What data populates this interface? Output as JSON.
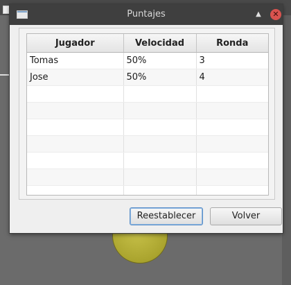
{
  "window": {
    "title": "Puntajes",
    "maximize_glyph": "▲",
    "close_glyph": "✕"
  },
  "table": {
    "columns": [
      "Jugador",
      "Velocidad",
      "Ronda"
    ],
    "rows": [
      [
        "Tomas",
        "50%",
        "3"
      ],
      [
        "Jose",
        "50%",
        "4"
      ],
      [
        "",
        "",
        ""
      ],
      [
        "",
        "",
        ""
      ],
      [
        "",
        "",
        ""
      ],
      [
        "",
        "",
        ""
      ],
      [
        "",
        "",
        ""
      ],
      [
        "",
        "",
        ""
      ],
      [
        "",
        "",
        ""
      ]
    ]
  },
  "buttons": {
    "reset_label": "Reestablecer",
    "back_label": "Volver"
  },
  "colors": {
    "titlebar": "#3f3f3f",
    "close_button": "#d9534f",
    "focus_border": "#5a8fc8",
    "background_ball": "#aaa42e"
  }
}
